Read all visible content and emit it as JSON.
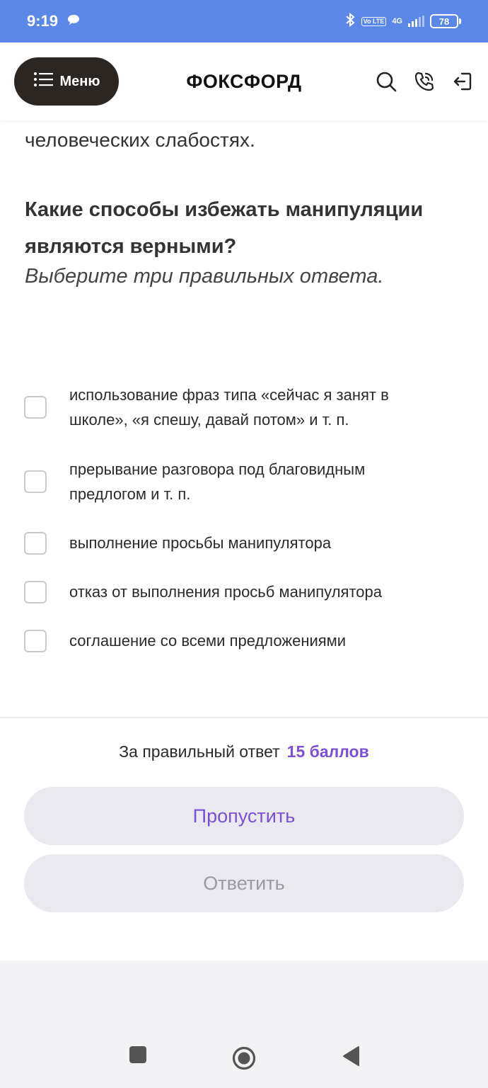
{
  "status_bar": {
    "time": "9:19",
    "volte": "Vo LTE",
    "network": "4G",
    "battery": "78"
  },
  "header": {
    "menu_label": "Меню",
    "brand": "ФОКСФОРД"
  },
  "content": {
    "previous_text": "человеческих слабостях.",
    "question": "Какие способы избежать манипуляции являются верными?",
    "instruction": "Выберите три правильных ответа.",
    "options": [
      {
        "label": "использование фраз типа «сейчас я занят в школе», «я спешу, давай потом» и т. п.",
        "checked": false
      },
      {
        "label": "прерывание разговора под благовидным предлогом и т. п.",
        "checked": false
      },
      {
        "label": "выполнение просьбы манипулятора",
        "checked": false
      },
      {
        "label": "отказ от выполнения просьб манипулятора",
        "checked": false
      },
      {
        "label": "соглашение со всеми предложениями",
        "checked": false
      }
    ]
  },
  "footer": {
    "points_label": "За правильный ответ",
    "points_value": "15 баллов",
    "skip_label": "Пропустить",
    "answer_label": "Ответить"
  },
  "colors": {
    "status_bar": "#5b87e8",
    "menu_button": "#2b2622",
    "accent": "#7b4fd6",
    "button_bg": "#e9e9ef"
  }
}
